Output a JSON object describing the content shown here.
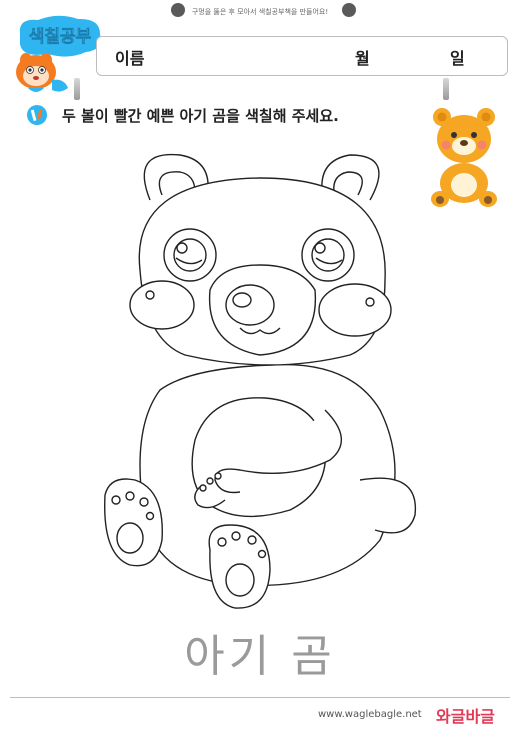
{
  "header": {
    "instruction": "구멍을 뚫은 후 모아서 색칠공부책을 만들어요!",
    "badge": "색칠공부",
    "name_label": "이름",
    "month_label": "월",
    "day_label": "일"
  },
  "task": {
    "text": "두 볼이 빨간 예쁜 아기 곰을 색칠해 주세요."
  },
  "picture": {
    "title": "아기 곰"
  },
  "footer": {
    "website": "www.waglebagle.net",
    "brand": "와글바글"
  },
  "colors": {
    "badge_bg": "#2fb6f0",
    "brand": "#e23b57",
    "hole": "#5a5a5a",
    "cheek_blush": "#f6a07a",
    "bear_fur": "#f5a623"
  }
}
